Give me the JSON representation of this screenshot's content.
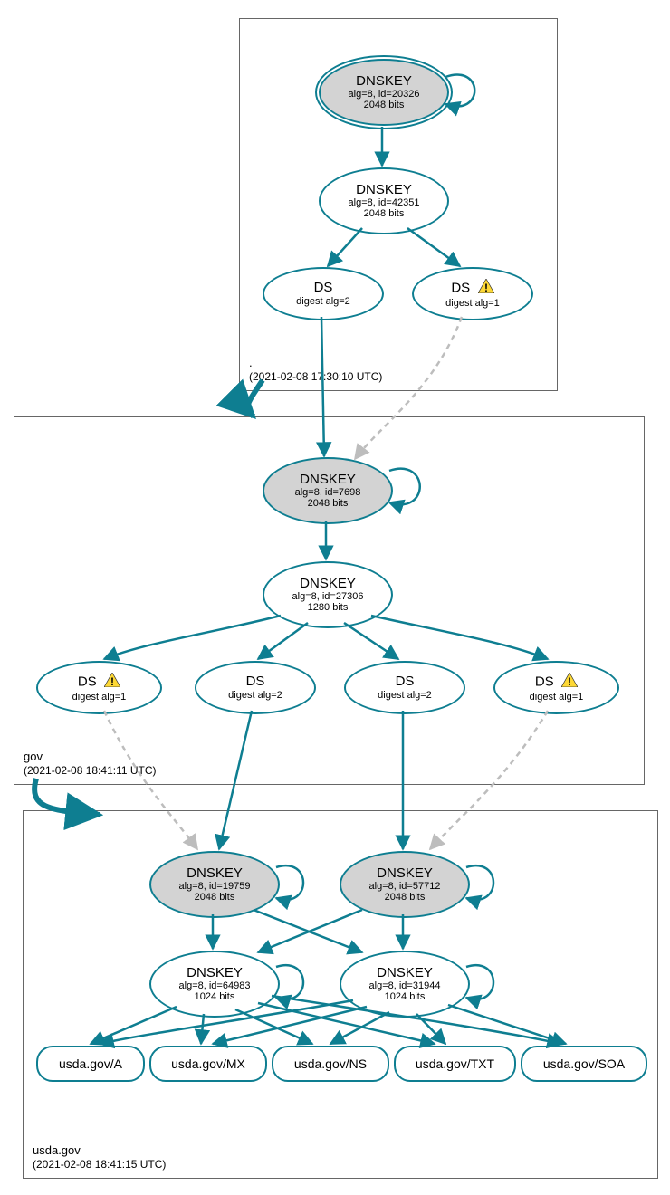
{
  "zones": {
    "root": {
      "name": ".",
      "timestamp": "(2021-02-08 17:30:10 UTC)"
    },
    "gov": {
      "name": "gov",
      "timestamp": "(2021-02-08 18:41:11 UTC)"
    },
    "usda": {
      "name": "usda.gov",
      "timestamp": "(2021-02-08 18:41:15 UTC)"
    }
  },
  "nodes": {
    "root_ksk": {
      "title": "DNSKEY",
      "sub1": "alg=8, id=20326",
      "sub2": "2048 bits"
    },
    "root_zsk": {
      "title": "DNSKEY",
      "sub1": "alg=8, id=42351",
      "sub2": "2048 bits"
    },
    "root_ds1": {
      "title": "DS",
      "sub1": "digest alg=2"
    },
    "root_ds2": {
      "title": "DS",
      "sub1": "digest alg=1"
    },
    "gov_ksk": {
      "title": "DNSKEY",
      "sub1": "alg=8, id=7698",
      "sub2": "2048 bits"
    },
    "gov_zsk": {
      "title": "DNSKEY",
      "sub1": "alg=8, id=27306",
      "sub2": "1280 bits"
    },
    "gov_ds1": {
      "title": "DS",
      "sub1": "digest alg=1"
    },
    "gov_ds2": {
      "title": "DS",
      "sub1": "digest alg=2"
    },
    "gov_ds3": {
      "title": "DS",
      "sub1": "digest alg=2"
    },
    "gov_ds4": {
      "title": "DS",
      "sub1": "digest alg=1"
    },
    "usda_ksk1": {
      "title": "DNSKEY",
      "sub1": "alg=8, id=19759",
      "sub2": "2048 bits"
    },
    "usda_ksk2": {
      "title": "DNSKEY",
      "sub1": "alg=8, id=57712",
      "sub2": "2048 bits"
    },
    "usda_zsk1": {
      "title": "DNSKEY",
      "sub1": "alg=8, id=64983",
      "sub2": "1024 bits"
    },
    "usda_zsk2": {
      "title": "DNSKEY",
      "sub1": "alg=8, id=31944",
      "sub2": "1024 bits"
    }
  },
  "rr": {
    "a": "usda.gov/A",
    "mx": "usda.gov/MX",
    "ns": "usda.gov/NS",
    "txt": "usda.gov/TXT",
    "soa": "usda.gov/SOA"
  },
  "colors": {
    "stroke": "#0e7e91",
    "fill_grey": "#d3d3d3",
    "dashed": "#bdbdbd"
  }
}
